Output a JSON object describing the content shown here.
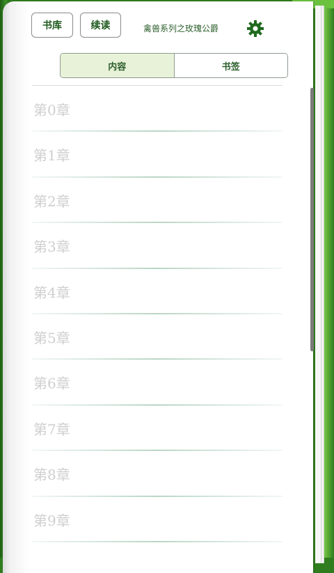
{
  "toolbar": {
    "library_label": "书库",
    "continue_label": "续读",
    "book_title": "禽兽系列之玫瑰公爵",
    "settings_icon": "gear-icon",
    "accent_color": "#1e6a1e"
  },
  "tabs": [
    {
      "label": "内容",
      "active": true
    },
    {
      "label": "书签",
      "active": false
    }
  ],
  "chapters": [
    {
      "label": "第0章"
    },
    {
      "label": "第1章"
    },
    {
      "label": "第2章"
    },
    {
      "label": "第3章"
    },
    {
      "label": "第4章"
    },
    {
      "label": "第5章"
    },
    {
      "label": "第6章"
    },
    {
      "label": "第7章"
    },
    {
      "label": "第8章"
    },
    {
      "label": "第9章"
    }
  ]
}
